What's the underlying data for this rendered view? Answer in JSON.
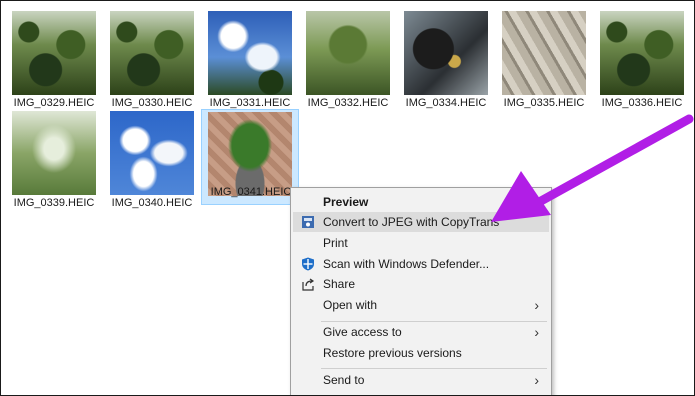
{
  "files": [
    {
      "name": "IMG_0329.HEIC",
      "thumb": "jungle"
    },
    {
      "name": "IMG_0330.HEIC",
      "thumb": "jungle"
    },
    {
      "name": "IMG_0331.HEIC",
      "thumb": "sky"
    },
    {
      "name": "IMG_0332.HEIC",
      "thumb": "trees"
    },
    {
      "name": "IMG_0334.HEIC",
      "thumb": "machine"
    },
    {
      "name": "IMG_0335.HEIC",
      "thumb": "stone"
    },
    {
      "name": "IMG_0336.HEIC",
      "thumb": "jungle"
    },
    {
      "name": "IMG_0339.HEIC",
      "thumb": "palm"
    },
    {
      "name": "IMG_0340.HEIC",
      "thumb": "clouds"
    },
    {
      "name": "IMG_0341.HEIC",
      "thumb": "plant",
      "selected": true
    }
  ],
  "context_menu": {
    "items": [
      {
        "label": "Preview",
        "bold": true
      },
      {
        "label": "Convert to JPEG with CopyTrans",
        "icon": "copytrans-icon",
        "highlighted": true
      },
      {
        "label": "Print"
      },
      {
        "label": "Scan with Windows Defender...",
        "icon": "windows-defender-icon"
      },
      {
        "label": "Share",
        "icon": "share-icon"
      },
      {
        "label": "Open with",
        "submenu": true
      },
      {
        "separator": true
      },
      {
        "label": "Give access to",
        "submenu": true
      },
      {
        "label": "Restore previous versions"
      },
      {
        "separator": true
      },
      {
        "label": "Send to",
        "submenu": true
      }
    ]
  },
  "annotation": {
    "color": "#b11ee6"
  },
  "colors": {
    "selection_fill": "#cce8ff",
    "selection_border": "#99d1ff",
    "menu_highlight": "#dcdcdc"
  }
}
